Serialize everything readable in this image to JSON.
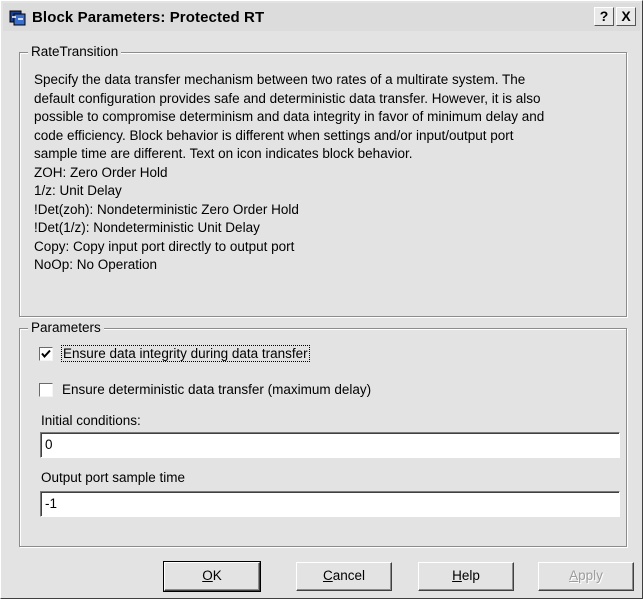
{
  "window": {
    "title": "Block Parameters: Protected RT",
    "help_label": "?",
    "close_label": "X"
  },
  "rate_group": {
    "legend": "RateTransition",
    "lines": [
      "Specify the data transfer mechanism between two rates of a multirate system. The",
      "default configuration provides safe and deterministic data transfer. However, it is also",
      "possible to compromise determinism and data integrity in favor of minimum delay and",
      "code efficiency. Block behavior is different when settings and/or input/output port",
      "sample time are different. Text on icon indicates block behavior.",
      "ZOH: Zero Order Hold",
      "1/z: Unit Delay",
      "!Det(zoh): Nondeterministic Zero Order Hold",
      "!Det(1/z): Nondeterministic Unit Delay",
      "Copy: Copy input port directly to output port",
      "NoOp: No Operation"
    ]
  },
  "params_group": {
    "legend": "Parameters",
    "integrity": {
      "label": "Ensure data integrity during data transfer",
      "checked": true
    },
    "deterministic": {
      "label": "Ensure deterministic data transfer (maximum delay)",
      "checked": false
    },
    "initial_conditions": {
      "label": "Initial conditions:",
      "value": "0"
    },
    "output_sample_time": {
      "label": "Output port sample time",
      "value": "-1"
    }
  },
  "buttons": {
    "ok": {
      "mnemonic": "O",
      "rest": "K"
    },
    "cancel": {
      "mnemonic": "C",
      "rest": "ancel"
    },
    "help": {
      "mnemonic": "H",
      "rest": "elp"
    },
    "apply": {
      "mnemonic": "A",
      "rest": "pply"
    }
  }
}
